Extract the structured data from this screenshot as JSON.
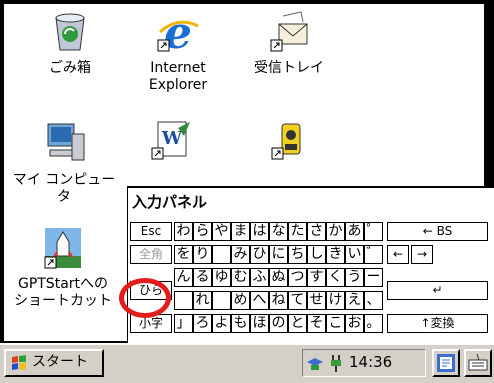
{
  "desktop": {
    "recycle_bin": "ごみ箱",
    "internet_explorer_line1": "Internet",
    "internet_explorer_line2": "Explorer",
    "inbox": "受信トレイ",
    "my_computer_line1": "マイ コンピュー",
    "my_computer_line2": "タ",
    "gptstart_line1": "GPTStartへの",
    "gptstart_line2": "ショートカット"
  },
  "ime_panel": {
    "title": "入力パネル",
    "row1": [
      "わ",
      "ら",
      "や",
      "ま",
      "は",
      "な",
      "た",
      "さ",
      "か",
      "あ",
      "゜"
    ],
    "row2": [
      "を",
      "り",
      "",
      "み",
      "ひ",
      "に",
      "ち",
      "し",
      "き",
      "い",
      "゛"
    ],
    "row3": [
      "ん",
      "る",
      "ゆ",
      "む",
      "ふ",
      "ぬ",
      "つ",
      "す",
      "く",
      "う",
      "ー"
    ],
    "row4": [
      "",
      "れ",
      "",
      "め",
      "へ",
      "ね",
      "て",
      "せ",
      "け",
      "え",
      "、"
    ],
    "row5": [
      "」",
      "ろ",
      "よ",
      "も",
      "ほ",
      "の",
      "と",
      "そ",
      "こ",
      "お",
      "。"
    ],
    "left_keys": {
      "esc": "Esc",
      "zenkaku": "全角",
      "hira": "ひら",
      "komoji": "小字"
    },
    "right_keys": {
      "bs": "← BS",
      "left": "←",
      "right": "→",
      "enter": "↵",
      "convert": "↑変換"
    }
  },
  "taskbar": {
    "start_label": "スタート",
    "clock": "14:36"
  },
  "colors": {
    "highlight_ring": "#e31c1c",
    "taskbar": "#d4d0c8"
  }
}
